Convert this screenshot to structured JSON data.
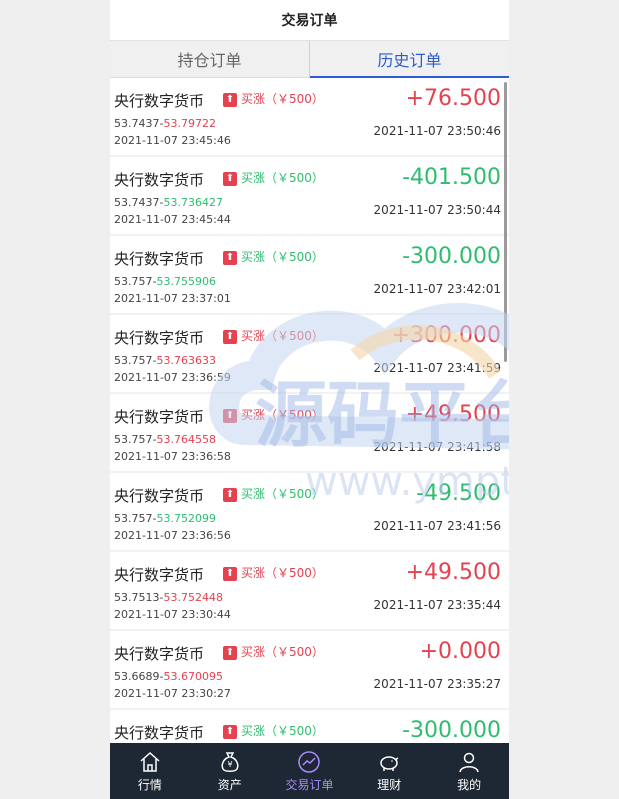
{
  "header": {
    "title": "交易订单"
  },
  "tabs": [
    {
      "label": "持仓订单",
      "active": false
    },
    {
      "label": "历史订单",
      "active": true
    }
  ],
  "orders": [
    {
      "name": "央行数字货币",
      "direction": "买涨（￥500）",
      "dir_color": "red",
      "open_price": "53.7437",
      "close_price": "53.79722",
      "close_color": "red",
      "open_time": "2021-11-07 23:45:46",
      "pl": "+76.500",
      "pl_color": "red",
      "close_time": "2021-11-07 23:50:46"
    },
    {
      "name": "央行数字货币",
      "direction": "买涨（￥500）",
      "dir_color": "green",
      "open_price": "53.7437",
      "close_price": "53.736427",
      "close_color": "green",
      "open_time": "2021-11-07 23:45:44",
      "pl": "-401.500",
      "pl_color": "green",
      "close_time": "2021-11-07 23:50:44"
    },
    {
      "name": "央行数字货币",
      "direction": "买涨（￥500）",
      "dir_color": "green",
      "open_price": "53.757",
      "close_price": "53.755906",
      "close_color": "green",
      "open_time": "2021-11-07 23:37:01",
      "pl": "-300.000",
      "pl_color": "green",
      "close_time": "2021-11-07 23:42:01"
    },
    {
      "name": "央行数字货币",
      "direction": "买涨（￥500）",
      "dir_color": "red",
      "open_price": "53.757",
      "close_price": "53.763633",
      "close_color": "red",
      "open_time": "2021-11-07 23:36:59",
      "pl": "+300.000",
      "pl_color": "red",
      "close_time": "2021-11-07 23:41:59"
    },
    {
      "name": "央行数字货币",
      "direction": "买涨（￥500）",
      "dir_color": "red",
      "open_price": "53.757",
      "close_price": "53.764558",
      "close_color": "red",
      "open_time": "2021-11-07 23:36:58",
      "pl": "+49.500",
      "pl_color": "red",
      "close_time": "2021-11-07 23:41:58"
    },
    {
      "name": "央行数字货币",
      "direction": "买涨（￥500）",
      "dir_color": "green",
      "open_price": "53.757",
      "close_price": "53.752099",
      "close_color": "green",
      "open_time": "2021-11-07 23:36:56",
      "pl": "-49.500",
      "pl_color": "green",
      "close_time": "2021-11-07 23:41:56"
    },
    {
      "name": "央行数字货币",
      "direction": "买涨（￥500）",
      "dir_color": "red",
      "open_price": "53.7513",
      "close_price": "53.752448",
      "close_color": "red",
      "open_time": "2021-11-07 23:30:44",
      "pl": "+49.500",
      "pl_color": "red",
      "close_time": "2021-11-07 23:35:44"
    },
    {
      "name": "央行数字货币",
      "direction": "买涨（￥500）",
      "dir_color": "red",
      "open_price": "53.6689",
      "close_price": "53.670095",
      "close_color": "red",
      "open_time": "2021-11-07 23:30:27",
      "pl": "+0.000",
      "pl_color": "red",
      "close_time": "2021-11-07 23:35:27"
    },
    {
      "name": "央行数字货币",
      "direction": "买涨（￥500）",
      "dir_color": "green",
      "open_price": "",
      "close_price": "",
      "close_color": "green",
      "open_time": "",
      "pl": "-300.000",
      "pl_color": "green",
      "close_time": ""
    }
  ],
  "nav": [
    {
      "label": "行情",
      "icon": "market-icon",
      "active": false
    },
    {
      "label": "资产",
      "icon": "money-bag-icon",
      "active": false
    },
    {
      "label": "交易订单",
      "icon": "chart-line-icon",
      "active": true
    },
    {
      "label": "理财",
      "icon": "piggy-bank-icon",
      "active": false
    },
    {
      "label": "我的",
      "icon": "user-icon",
      "active": false
    }
  ],
  "watermark": {
    "text": "源码平台",
    "url": "www.ympt.cc"
  },
  "colors": {
    "red": "#e5414f",
    "green": "#2ebd6e",
    "accent": "#2d5bd1",
    "nav_bg": "#1e2734",
    "nav_active": "#a78bfa"
  }
}
